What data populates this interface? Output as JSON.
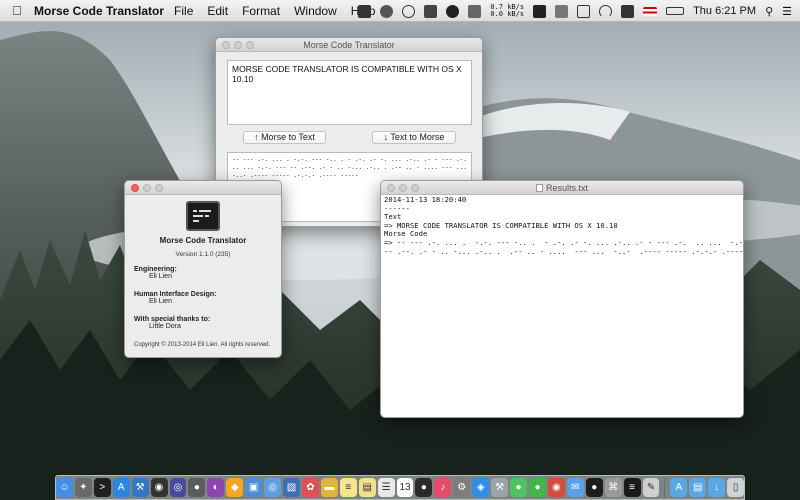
{
  "menubar": {
    "app_name": "Morse Code Translator",
    "menus": [
      "File",
      "Edit",
      "Format",
      "Window",
      "Help"
    ],
    "net_up": "0.7 kB/s",
    "net_down": "0.0 kB/s",
    "clock": "Thu 6:21 PM"
  },
  "main_window": {
    "title": "Morse Code Translator",
    "input_text": "MORSE CODE TRANSLATOR IS COMPATIBLE WITH OS X 10.10",
    "morse_to_text_label": "↑ Morse to Text",
    "text_to_morse_label": "↓ Text to Morse",
    "morse_output": "-- --- .-. ... .  -.-. --- -.. .  - .-. .- -. ... .-.. .- - --- .-.  .. ...  -.-. --- -- .--. .- - .. -... .-.. .  .-- .. - ....  --- ...  -..-  .---- ----- .-.-.- .---- -----"
  },
  "about_window": {
    "app_title": "Morse Code Translator",
    "version": "Version 1.1.0 (235)",
    "credits": [
      {
        "heading": "Engineering:",
        "name": "Eli Lien"
      },
      {
        "heading": "Human Interface Design:",
        "name": "Eli Lien"
      },
      {
        "heading": "With special thanks to:",
        "name": "Little Dora"
      }
    ],
    "copyright": "Copyright © 2013-2014 Eli Lien. All rights reserved."
  },
  "results_window": {
    "title": "Results.txt",
    "lines": [
      "2014-11-13 18:20:40",
      "------",
      "Text",
      "=> MORSE CODE TRANSLATOR IS COMPATIBLE WITH OS X 10.10",
      "Morse Code",
      "=> -- --- .-. ... .  -.-. --- -.. .  - .-. .- -. ... .-.. .- - --- .-.  .. ...  -.-. ---",
      "-- .--. .- - .. -... .-.. .  .-- .. - ....  --- ...  -..-  .---- ----- .-.-.- .---- -----"
    ]
  },
  "dock": {
    "items": [
      {
        "icon": "finder-icon",
        "color": "#3f8ee8",
        "glyph": "☺"
      },
      {
        "icon": "launchpad-icon",
        "color": "#6a6a6a",
        "glyph": "✦"
      },
      {
        "icon": "terminal-icon",
        "color": "#202020",
        "glyph": ">"
      },
      {
        "icon": "app-store-icon",
        "color": "#2a86e0",
        "glyph": "A"
      },
      {
        "icon": "xcode-icon",
        "color": "#3378c4",
        "glyph": "⚒"
      },
      {
        "icon": "activity-monitor-icon",
        "color": "#333333",
        "glyph": "◉"
      },
      {
        "icon": "instruments-icon",
        "color": "#4a4a9a",
        "glyph": "◎"
      },
      {
        "icon": "disk-utility-icon",
        "color": "#5b5b5b",
        "glyph": "●"
      },
      {
        "icon": "github-icon",
        "color": "#8e44ad",
        "glyph": "◐"
      },
      {
        "icon": "sketch-icon",
        "color": "#f5a623",
        "glyph": "◆"
      },
      {
        "icon": "simulator-icon",
        "color": "#4a90d9",
        "glyph": "▣"
      },
      {
        "icon": "network-icon",
        "color": "#5da0e0",
        "glyph": "◎"
      },
      {
        "icon": "preview-icon",
        "color": "#3d6fb6",
        "glyph": "▧"
      },
      {
        "icon": "photos-icon",
        "color": "#e05050",
        "glyph": "✿"
      },
      {
        "icon": "folder-icon",
        "color": "#e3b341",
        "glyph": "▬"
      },
      {
        "icon": "notes-icon",
        "color": "#f7e58a",
        "glyph": "≡"
      },
      {
        "icon": "stickies-icon",
        "color": "#f1e08c",
        "glyph": "▤"
      },
      {
        "icon": "reminders-icon",
        "color": "#e8e8e8",
        "glyph": "☰"
      },
      {
        "icon": "calendar-icon",
        "color": "#ffffff",
        "glyph": "13"
      },
      {
        "icon": "dvd-player-icon",
        "color": "#2b2b2b",
        "glyph": "●"
      },
      {
        "icon": "music-icon",
        "color": "#e54b6b",
        "glyph": "♪"
      },
      {
        "icon": "settings-icon",
        "color": "#7d7d7d",
        "glyph": "⚙"
      },
      {
        "icon": "safari-icon",
        "color": "#2f8fe8",
        "glyph": "◈"
      },
      {
        "icon": "utilities-icon",
        "color": "#9aa4a8",
        "glyph": "⚒"
      },
      {
        "icon": "messages-icon",
        "color": "#4fc35d",
        "glyph": "●"
      },
      {
        "icon": "wechat-icon",
        "color": "#43b649",
        "glyph": "●"
      },
      {
        "icon": "chrome-icon",
        "color": "#d84b3a",
        "glyph": "◉"
      },
      {
        "icon": "mail-icon",
        "color": "#5aa0e6",
        "glyph": "✉"
      },
      {
        "icon": "qq-icon",
        "color": "#1c1c1c",
        "glyph": "●"
      },
      {
        "icon": "keychain-icon",
        "color": "#9a9a9a",
        "glyph": "⌘"
      },
      {
        "icon": "morse-app-icon",
        "color": "#1b1b1b",
        "glyph": "≡"
      },
      {
        "icon": "text-edit-icon",
        "color": "#cfcfcf",
        "glyph": "✎"
      }
    ],
    "trailing": [
      {
        "icon": "applications-folder-icon",
        "color": "#5aa7e6",
        "glyph": "A"
      },
      {
        "icon": "documents-folder-icon",
        "color": "#5aa7e6",
        "glyph": "▤"
      },
      {
        "icon": "downloads-folder-icon",
        "color": "#5aa7e6",
        "glyph": "↓"
      },
      {
        "icon": "trash-icon",
        "color": "#cdd3d6",
        "glyph": "▯"
      }
    ]
  }
}
